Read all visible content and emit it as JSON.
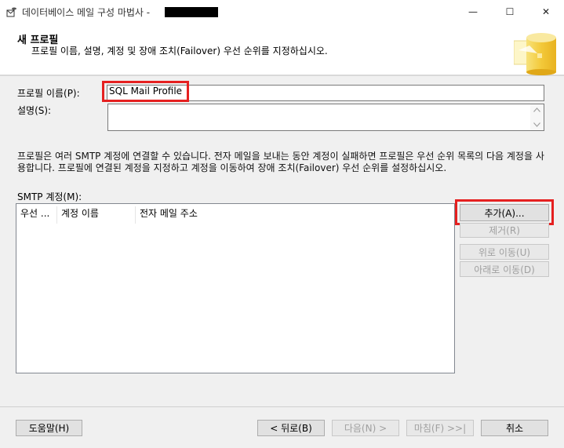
{
  "window": {
    "title": "데이터베이스 메일 구성 마법사 -",
    "minimize_label": "—",
    "maximize_label": "☐",
    "close_label": "✕"
  },
  "header": {
    "title": "새 프로필",
    "subtitle": "프로필 이름, 설명, 계정 및 장애 조치(Failover) 우선 순위를 지정하십시오."
  },
  "form": {
    "profile_name_label": "프로필 이름(P):",
    "profile_name_value": "SQL Mail Profile",
    "description_label": "설명(S):",
    "description_value": ""
  },
  "info_text": "프로필은 여러 SMTP 계정에 연결할 수 있습니다. 전자 메일을 보내는 동안 계정이 실패하면 프로필은 우선 순위 목록의 다음 계정을 사용합니다. 프로필에 연결된 계정을 지정하고 계정을 이동하여 장애 조치(Failover) 우선 순위를 설정하십시오.",
  "smtp": {
    "label": "SMTP 계정(M):",
    "columns": [
      "우선 ...",
      "계정 이름",
      "전자 메일 주소"
    ],
    "rows": []
  },
  "side_buttons": {
    "add": "추가(A)...",
    "remove": "제거(R)",
    "move_up": "위로 이동(U)",
    "move_down": "아래로 이동(D)"
  },
  "footer": {
    "help": "도움말(H)",
    "back": "< 뒤로(B)",
    "next": "다음(N) >",
    "finish": "마침(F) >>|",
    "cancel": "취소"
  },
  "colors": {
    "highlight": "#e52020",
    "background": "#f0f0f0"
  }
}
